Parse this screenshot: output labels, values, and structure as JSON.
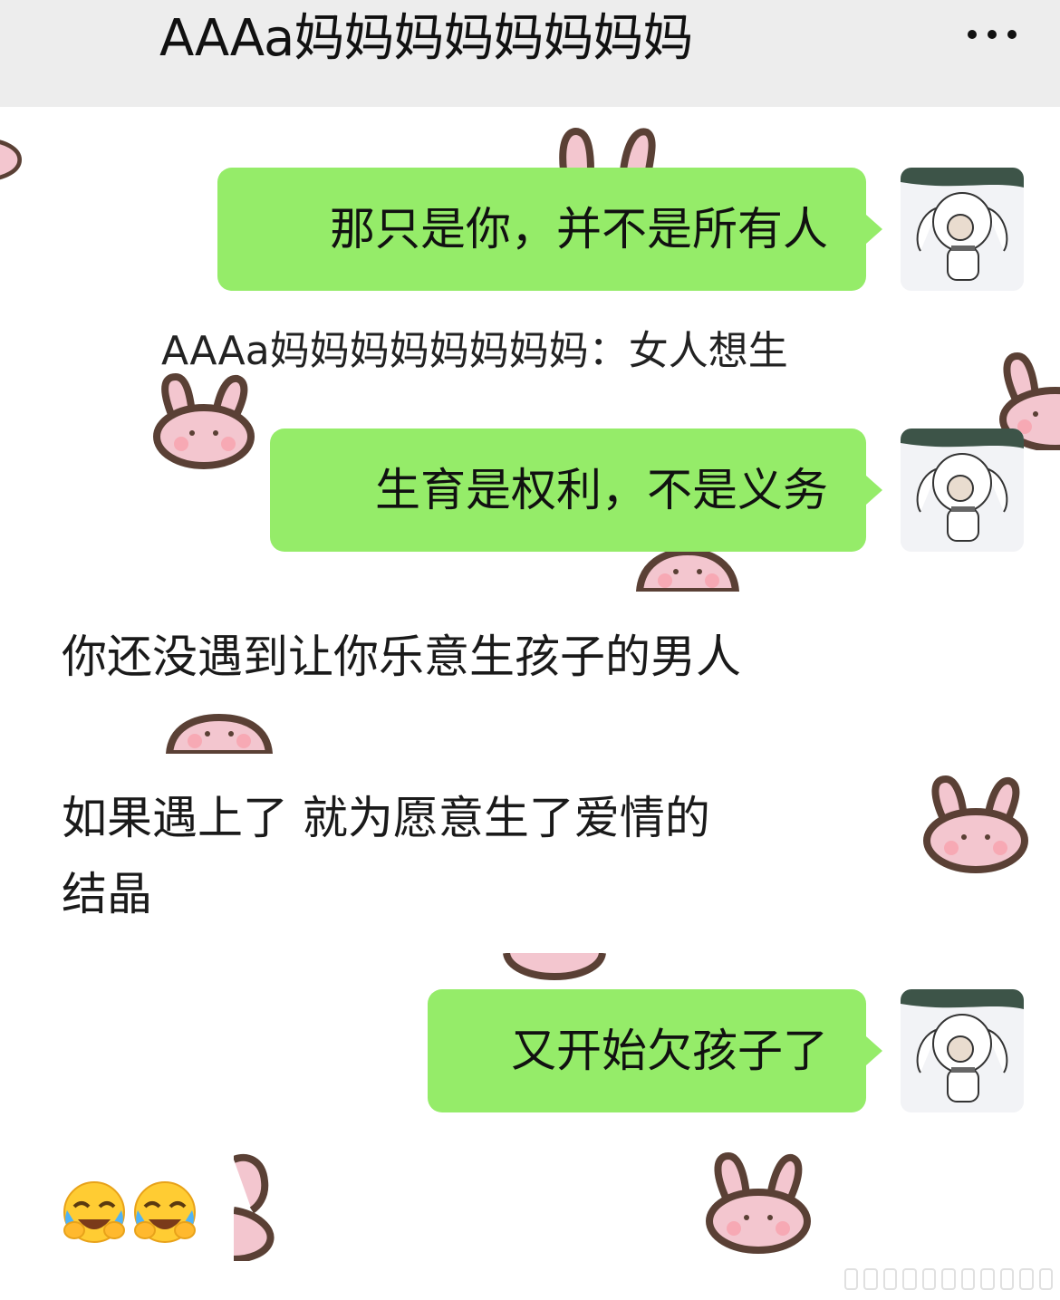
{
  "header": {
    "title": "AAAa妈妈妈妈妈妈妈妈"
  },
  "messages": {
    "m1": "那只是你，并不是所有人",
    "sender_line": "AAAa妈妈妈妈妈妈妈妈：女人想生",
    "m2": "生育是权利，不是义务",
    "m3": "你还没遇到让你乐意生孩子的男人",
    "m4_line1": "如果遇上了  就为愿意生了爱情的",
    "m4_line2": "结晶",
    "m5": "又开始欠孩子了"
  },
  "icons": {
    "more": "more-dots-icon",
    "bunny": "bunny-sticker-icon",
    "emoji": "face-with-tears-of-joy-icon"
  },
  "colors": {
    "header_bg": "#ededed",
    "bubble_green": "#95ec69",
    "bunny_pink": "#f3c6cf",
    "bunny_outline": "#5a4035"
  }
}
